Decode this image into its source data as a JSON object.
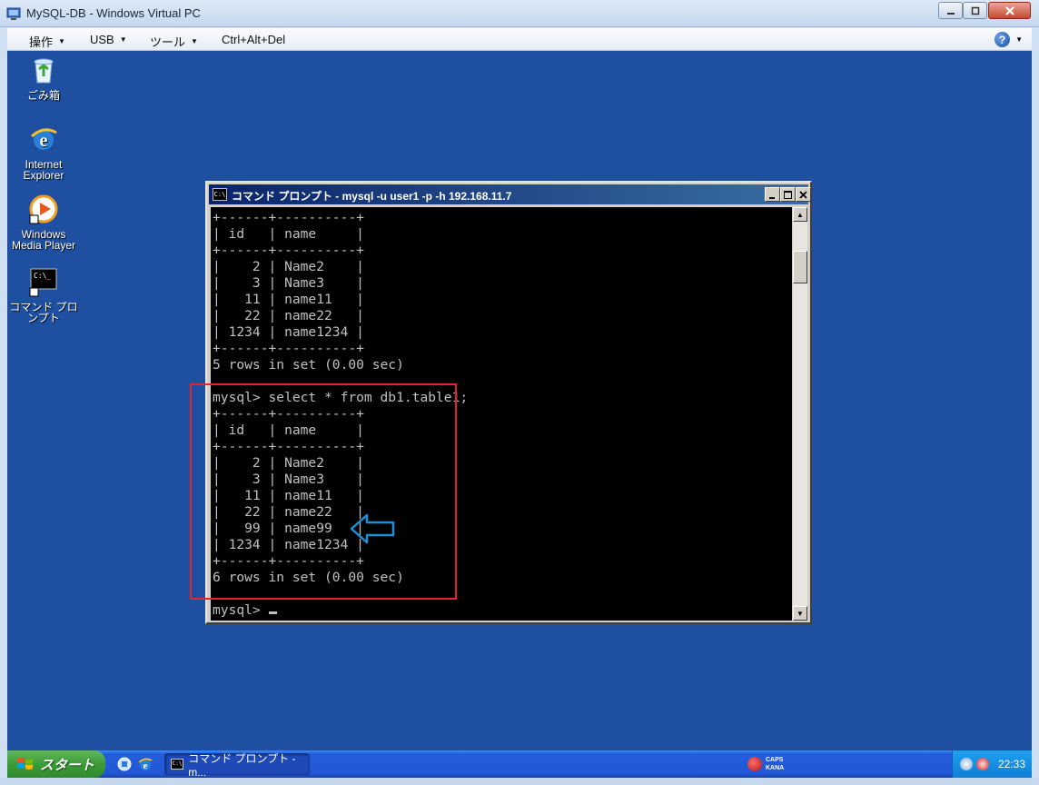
{
  "host": {
    "title": "MySQL-DB - Windows Virtual PC",
    "menu": [
      "操作",
      "USB",
      "ツール",
      "Ctrl+Alt+Del"
    ],
    "help_icon": "help-icon"
  },
  "desktop": {
    "icons": [
      {
        "label": "ごみ箱",
        "icon": "recycle-bin-icon"
      },
      {
        "label": "Internet Explorer",
        "icon": "internet-explorer-icon"
      },
      {
        "label": "Windows Media Player",
        "icon": "windows-media-player-icon"
      },
      {
        "label": "コマンド プロンプト",
        "icon": "command-prompt-icon"
      }
    ]
  },
  "console_window": {
    "title": "コマンド プロンプト - mysql -u user1 -p -h 192.168.11.7",
    "icon_text": "C:\\",
    "lines": [
      "+------+----------+",
      "| id   | name     |",
      "+------+----------+",
      "|    2 | Name2    |",
      "|    3 | Name3    |",
      "|   11 | name11   |",
      "|   22 | name22   |",
      "| 1234 | name1234 |",
      "+------+----------+",
      "5 rows in set (0.00 sec)",
      "",
      "mysql> select * from db1.table1;",
      "+------+----------+",
      "| id   | name     |",
      "+------+----------+",
      "|    2 | Name2    |",
      "|    3 | Name3    |",
      "|   11 | name11   |",
      "|   22 | name22   |",
      "|   99 | name99   |",
      "| 1234 | name1234 |",
      "+------+----------+",
      "6 rows in set (0.00 sec)",
      "",
      "mysql> "
    ]
  },
  "annotations": {
    "highlight_color": "#e0262c",
    "arrow_color": "#1e8fd6"
  },
  "taskbar": {
    "start_label": "スタート",
    "task_button_label": "コマンド プロンプト - m...",
    "ime": {
      "caps": "CAPS",
      "kana": "KANA"
    },
    "clock": "22:33"
  }
}
